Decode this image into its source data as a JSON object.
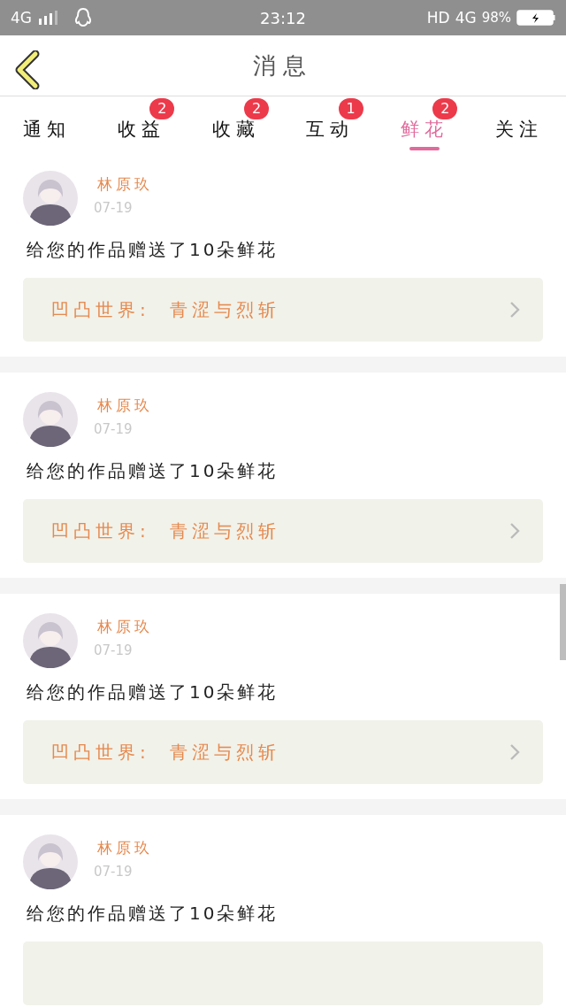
{
  "status_bar": {
    "network": "4G",
    "time": "23:12",
    "hd": "HD",
    "network_right": "4G",
    "battery": "98%"
  },
  "header": {
    "title": "消息"
  },
  "tabs": [
    {
      "label": "通知",
      "selected": false
    },
    {
      "label": "收益",
      "badge": "2",
      "selected": false
    },
    {
      "label": "收藏",
      "badge": "2",
      "selected": false
    },
    {
      "label": "互动",
      "badge": "1",
      "selected": false
    },
    {
      "label": "鲜花",
      "badge": "2",
      "selected": true
    },
    {
      "label": "关注",
      "selected": false
    }
  ],
  "messages": [
    {
      "name": "林原玖",
      "date": "07-19",
      "text": "给您的作品赠送了10朵鲜花",
      "work_title": "凹凸世界:  青涩与烈斩"
    },
    {
      "name": "林原玖",
      "date": "07-19",
      "text": "给您的作品赠送了10朵鲜花",
      "work_title": "凹凸世界:  青涩与烈斩"
    },
    {
      "name": "林原玖",
      "date": "07-19",
      "text": "给您的作品赠送了10朵鲜花",
      "work_title": "凹凸世界:  青涩与烈斩"
    },
    {
      "name": "林原玖",
      "date": "07-19",
      "text": "给您的作品赠送了10朵鲜花"
    }
  ]
}
